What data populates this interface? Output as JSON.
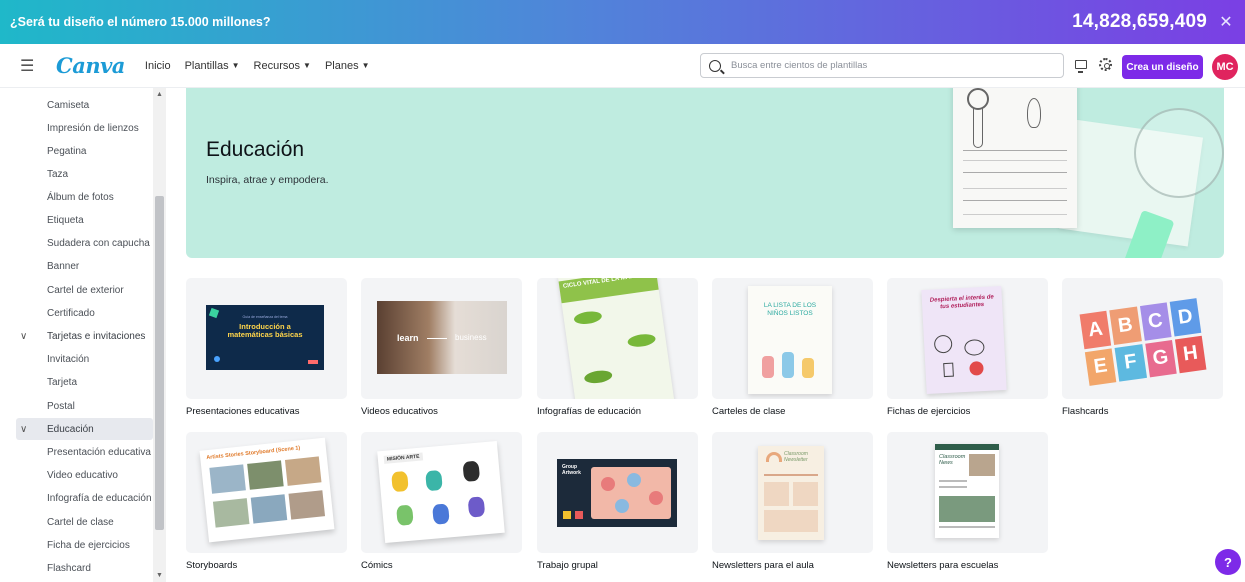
{
  "promo": {
    "message": "¿Será tu diseño el número 15.000 millones?",
    "counter": "14,828,659,409",
    "close_icon": "close-icon"
  },
  "nav": {
    "logo": "Canva",
    "links": [
      {
        "label": "Inicio",
        "has_chevron": false
      },
      {
        "label": "Plantillas",
        "has_chevron": true
      },
      {
        "label": "Recursos",
        "has_chevron": true
      },
      {
        "label": "Planes",
        "has_chevron": true
      }
    ],
    "search_placeholder": "Busca entre cientos de plantillas",
    "create_button": "Crea un diseño",
    "avatar_initials": "MC"
  },
  "sidebar": {
    "items": [
      {
        "label": "Camiseta"
      },
      {
        "label": "Impresión de lienzos"
      },
      {
        "label": "Pegatina"
      },
      {
        "label": "Taza"
      },
      {
        "label": "Álbum de fotos"
      },
      {
        "label": "Etiqueta"
      },
      {
        "label": "Sudadera con capucha"
      },
      {
        "label": "Banner"
      },
      {
        "label": "Cartel de exterior"
      },
      {
        "label": "Certificado"
      },
      {
        "label": "Tarjetas e invitaciones",
        "category": true
      },
      {
        "label": "Invitación"
      },
      {
        "label": "Tarjeta"
      },
      {
        "label": "Postal"
      },
      {
        "label": "Educación",
        "category": true,
        "active": true
      },
      {
        "label": "Presentación educativa"
      },
      {
        "label": "Video educativo"
      },
      {
        "label": "Infografía de educación"
      },
      {
        "label": "Cartel de clase"
      },
      {
        "label": "Ficha de ejercicios"
      },
      {
        "label": "Flashcard"
      }
    ]
  },
  "hero": {
    "title": "Educación",
    "subtitle": "Inspira, atrae y empodera."
  },
  "cards": [
    {
      "label": "Presentaciones educativas"
    },
    {
      "label": "Videos educativos"
    },
    {
      "label": "Infografías de educación"
    },
    {
      "label": "Carteles de clase"
    },
    {
      "label": "Fichas de ejercicios"
    },
    {
      "label": "Flashcards"
    },
    {
      "label": "Storyboards"
    },
    {
      "label": "Cómics"
    },
    {
      "label": "Trabajo grupal"
    },
    {
      "label": "Newsletters para el aula"
    },
    {
      "label": "Newsletters para escuelas"
    }
  ],
  "thumb_text": {
    "presentation_small": "Guía de enseñanza del tema",
    "presentation_title": "Introducción a matemáticas básicas",
    "video_left": "learn",
    "video_right": "business",
    "infographic_title": "CICLO VITAL DE LA MARIPOSA",
    "poster_title": "LA LISTA DE LOS NIÑOS LISTOS",
    "worksheet_title": "Despierta el interés de tus estudiantes",
    "flash_letters": [
      "A",
      "B",
      "C",
      "D",
      "E",
      "F",
      "G",
      "H"
    ],
    "storyboard_title": "Artists Stories Storyboard (Scene 1)",
    "comic_title": "MISIÓN ARTE",
    "group_title": "Group Artwork",
    "classroom_title": "Classroom Newsletter",
    "school_title": "Classroom News"
  },
  "help_label": "?",
  "colors": {
    "accent": "#7d2ae8",
    "hero_bg": "#bfece0",
    "avatar": "#e0245e",
    "logo": "#1c9bd6"
  }
}
